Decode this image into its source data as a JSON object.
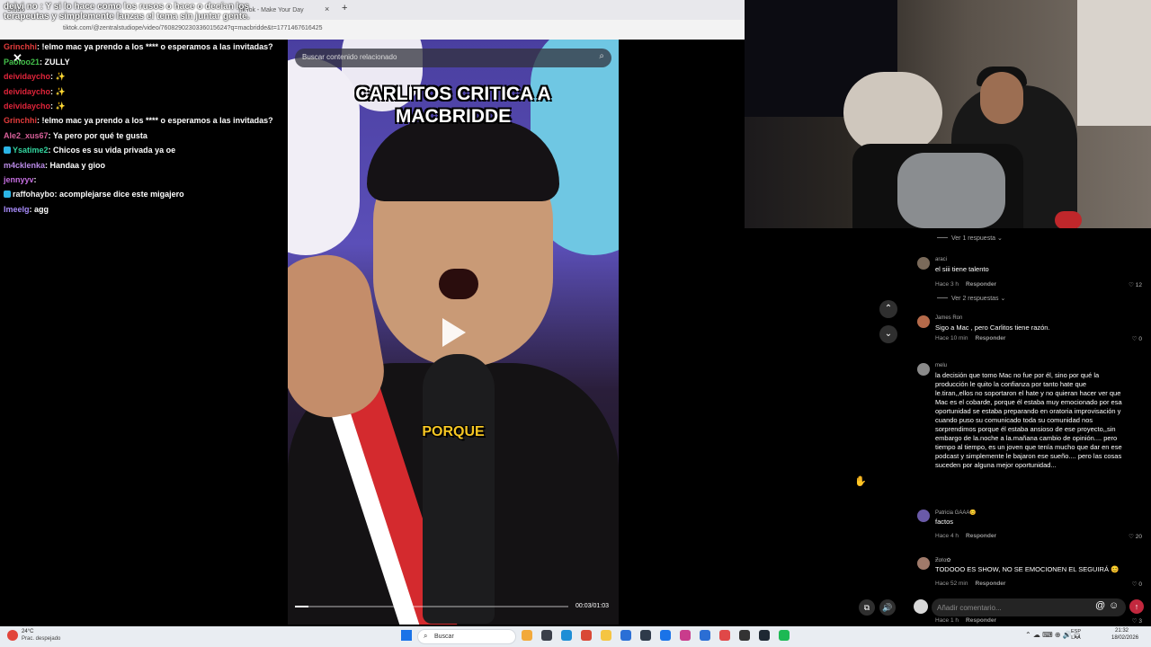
{
  "browser": {
    "tabs": [
      "Studio",
      "",
      "TikTok - Make Your Day",
      ""
    ],
    "url": "tiktok.com/@zentralstudiope/video/7608290230336015624?q=macbridde&t=1771467616425",
    "new_tab": "+",
    "tab_close": "×"
  },
  "overlay": {
    "text": "deivi no : Y si lo hace como los rusos o hace o decían los terapeutas y simplemente lanzas el tema sin juntar gente.",
    "close": "✕"
  },
  "chat": {
    "messages": [
      {
        "user": "Paoloo21",
        "text": ": ZULLY",
        "color": "#43c04a",
        "badge": false
      },
      {
        "user": "Grinchhi",
        "text": ": !elmo mac ya prendo a los **** o esperamos a las invitadas?",
        "color": "#e23b3b",
        "badge": false
      },
      {
        "user": "Paoloo21",
        "text": ": ZULLY",
        "color": "#43c04a",
        "badge": false
      },
      {
        "user": "deividaycho",
        "text": ": ✨",
        "color": "#e0243a",
        "badge": false
      },
      {
        "user": "deividaycho",
        "text": ": ✨",
        "color": "#e0243a",
        "badge": false
      },
      {
        "user": "deividaycho",
        "text": ": ✨",
        "color": "#e0243a",
        "badge": false
      },
      {
        "user": "Grinchhi",
        "text": ": !elmo mac ya prendo a los **** o esperamos a las invitadas?",
        "color": "#e23b3b",
        "badge": false
      },
      {
        "user": "Ale2_xus67",
        "text": ": Ya pero por qué te gusta",
        "color": "#d9609a",
        "badge": false
      },
      {
        "user": "Ysatime2",
        "text": ": Chicos es su vida privada ya oe",
        "color": "#33d6a0",
        "badge": true
      },
      {
        "user": "m4cklenka",
        "text": ": Handaa y gioo",
        "color": "#b98ae6",
        "badge": false
      },
      {
        "user": "jennyyv",
        "text": ": ",
        "color": "#c56ee0",
        "badge": false
      },
      {
        "user": "raffohaybo",
        "text": ": acomplejarse dice este migajero",
        "color": "#f2f2f2",
        "badge": true
      },
      {
        "user": "Imeelg",
        "text": ": agg",
        "color": "#a78bfa",
        "badge": false
      }
    ]
  },
  "video": {
    "search_placeholder": "Buscar contenido relacionado",
    "title": "CARLITOS CRITICA A MACBRIDDE",
    "caption": "PORQUE",
    "time": "00:03/01:03",
    "progress": 0.05
  },
  "comments": {
    "top_replies": "Ver 1 respuesta",
    "items": [
      {
        "user": "araci",
        "text": "el siii tiene talento",
        "time": "Hace 3 h",
        "reply": "Responder",
        "likes": "12",
        "replies": "Ver 2 respuestas",
        "avatar_color": "#7a6a5a"
      },
      {
        "user": "James Ron",
        "text": "Sigo a Mac , pero Carlitos tiene razón.",
        "time": "Hace 10 min",
        "reply": "Responder",
        "likes": "0",
        "replies": "",
        "avatar_color": "#b56a4a"
      },
      {
        "user": "melu",
        "text": "la decisión que tomo Mac no fue por él, sino por qué la producción le quito la confianza por tanto hate que le.tiran,,ellos no soportaron el hate y no quieran hacer ver que Mac es el cobarde, porque él estaba muy emocionado por esa oportunidad se estaba preparando en oratoria improvisación y cuando puso su comunicado toda su comunidad nos sorprendimos porque él estaba ansioso de ese proyecto,,sin embargo de la.noche a la.mañana cambio de opinión.... pero tiempo al tiempo, es un joven que tenía mucho que dar en ese podcast y simplemente le bajaron ese sueño.... pero las cosas suceden por alguna mejor oportunidad...",
        "time": "Hace 1 h",
        "reply": "Responder",
        "likes": "3",
        "replies": "",
        "avatar_color": "#8a8a8a"
      },
      {
        "user": "Patricia GAAA😊",
        "text": "factos",
        "time": "Hace 4 h",
        "reply": "Responder",
        "likes": "20",
        "replies": "",
        "avatar_color": "#6a5aa8"
      },
      {
        "user": "Ƶαℓα✿",
        "text": "TODOOO ES SHOW, NO SE EMOCIONEN EL SEGUIRÁ 😊",
        "time": "Hace 52 min",
        "reply": "Responder",
        "likes": "0",
        "replies": "",
        "avatar_color": "#a07a6a"
      }
    ],
    "input_placeholder": "Añadir comentario...",
    "mention": "@",
    "emoji": "☺",
    "send": "↑"
  },
  "controls": {
    "up": "⌃",
    "down": "⌄",
    "misc": "⧉",
    "volume": "🔊"
  },
  "taskbar": {
    "weather_temp": "24°C",
    "weather_cond": "Prac. despejado",
    "search": "Buscar",
    "search_icon": "⌕",
    "lang_line1": "ESP",
    "lang_line2": "LAA",
    "time": "21:32",
    "date": "18/02/2026",
    "tray": "⌃  ☁  ⌨      ⊕  🔊  ▭",
    "app_colors": [
      "#f2a93b",
      "#3a3f4a",
      "#1e8ed6",
      "#d94836",
      "#f5c542",
      "#2a6fd6",
      "#2e3a4a",
      "#1a73e8",
      "#c93c8c",
      "#2b6ed4",
      "#e04848",
      "#333333",
      "#1e2833",
      "#1db954"
    ]
  }
}
